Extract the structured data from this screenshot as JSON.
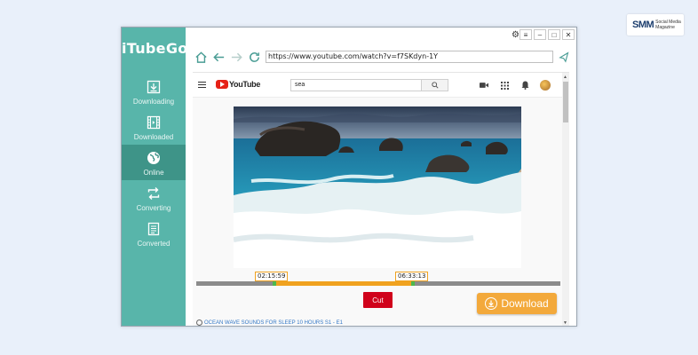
{
  "app": {
    "name": "iTubeGo"
  },
  "sidebar": {
    "items": [
      {
        "label": "Downloading",
        "icon": "download-icon",
        "active": false
      },
      {
        "label": "Downloaded",
        "icon": "film-icon",
        "active": false
      },
      {
        "label": "Online",
        "icon": "globe-icon",
        "active": true
      },
      {
        "label": "Converting",
        "icon": "convert-icon",
        "active": false
      },
      {
        "label": "Converted",
        "icon": "document-icon",
        "active": false
      }
    ]
  },
  "window": {
    "controls": [
      "settings-icon",
      "menu-icon",
      "minimize-icon",
      "maximize-icon",
      "close-icon"
    ]
  },
  "browser": {
    "url": "https://www.youtube.com/watch?v=f7SKdyn-1Y"
  },
  "youtube": {
    "logo_text": "YouTube",
    "search_value": "sea",
    "icons": [
      "video-camera-icon",
      "apps-icon",
      "bell-icon",
      "avatar"
    ]
  },
  "player": {
    "start_time": "02:15:59",
    "end_time": "06:33:13",
    "selection_start": 0.21,
    "selection_end": 0.6
  },
  "actions": {
    "cut_label": "Cut",
    "download_label": "Download"
  },
  "video_title": "OCEAN WAVE SOUNDS FOR SLEEP 10 HOURS  S1 - E1",
  "badge": {
    "brand": "SMM",
    "sub_line1": "Social Media",
    "sub_line2": "Magazine"
  },
  "colors": {
    "sidebar": "#58b5aa",
    "sidebar_active": "#3e9488",
    "accent_orange": "#f3a93b",
    "cut_red": "#d0021b"
  }
}
